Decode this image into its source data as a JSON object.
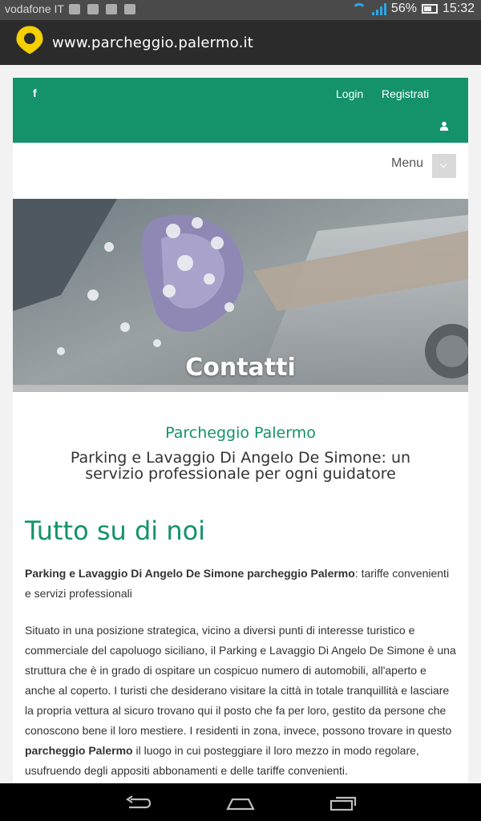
{
  "status_bar": {
    "carrier": "vodafone IT",
    "battery": "56%",
    "time": "15:32",
    "icons": [
      "usb-icon",
      "image-icon",
      "game-icon",
      "media-icon",
      "wifi-icon",
      "signal-icon",
      "battery-icon"
    ]
  },
  "browser": {
    "url": "www.parcheggio.palermo.it"
  },
  "header": {
    "facebook": "f",
    "login": "Login",
    "register": "Registrati"
  },
  "menu": {
    "label": "Menu"
  },
  "hero": {
    "title": "Contatti"
  },
  "intro": {
    "brand": "Parcheggio Palermo",
    "tagline": "Parking e Lavaggio Di Angelo De Simone: un servizio professionale per ogni guidatore"
  },
  "about": {
    "heading": "Tutto su di noi",
    "p1_bold": "Parking e Lavaggio Di Angelo De Simone parcheggio Palermo",
    "p1_rest": ": tariffe convenienti e servizi professionali",
    "p2_a": "Situato in una posizione strategica, vicino a diversi punti di interesse turistico e commerciale del capoluogo siciliano, il Parking e Lavaggio Di Angelo De Simone è una struttura che è in grado di ospitare un cospicuo numero di automobili, all'aperto e anche al coperto. I turisti che desiderano visitare la città in totale tranquillità e lasciare la propria vettura al sicuro trovano qui il posto che fa per loro, gestito da persone che conoscono bene il loro mestiere. I residenti in zona, invece, possono trovare in questo ",
    "p2_bold": "parcheggio Palermo",
    "p2_b": " il luogo in cui posteggiare il loro mezzo in modo regolare, usufruendo degli appositi abbonamenti e delle tariffe convenienti."
  },
  "colors": {
    "brand_green": "#14926c",
    "url_bar": "#2b2b2b",
    "status_bar": "#4a4a4a"
  }
}
